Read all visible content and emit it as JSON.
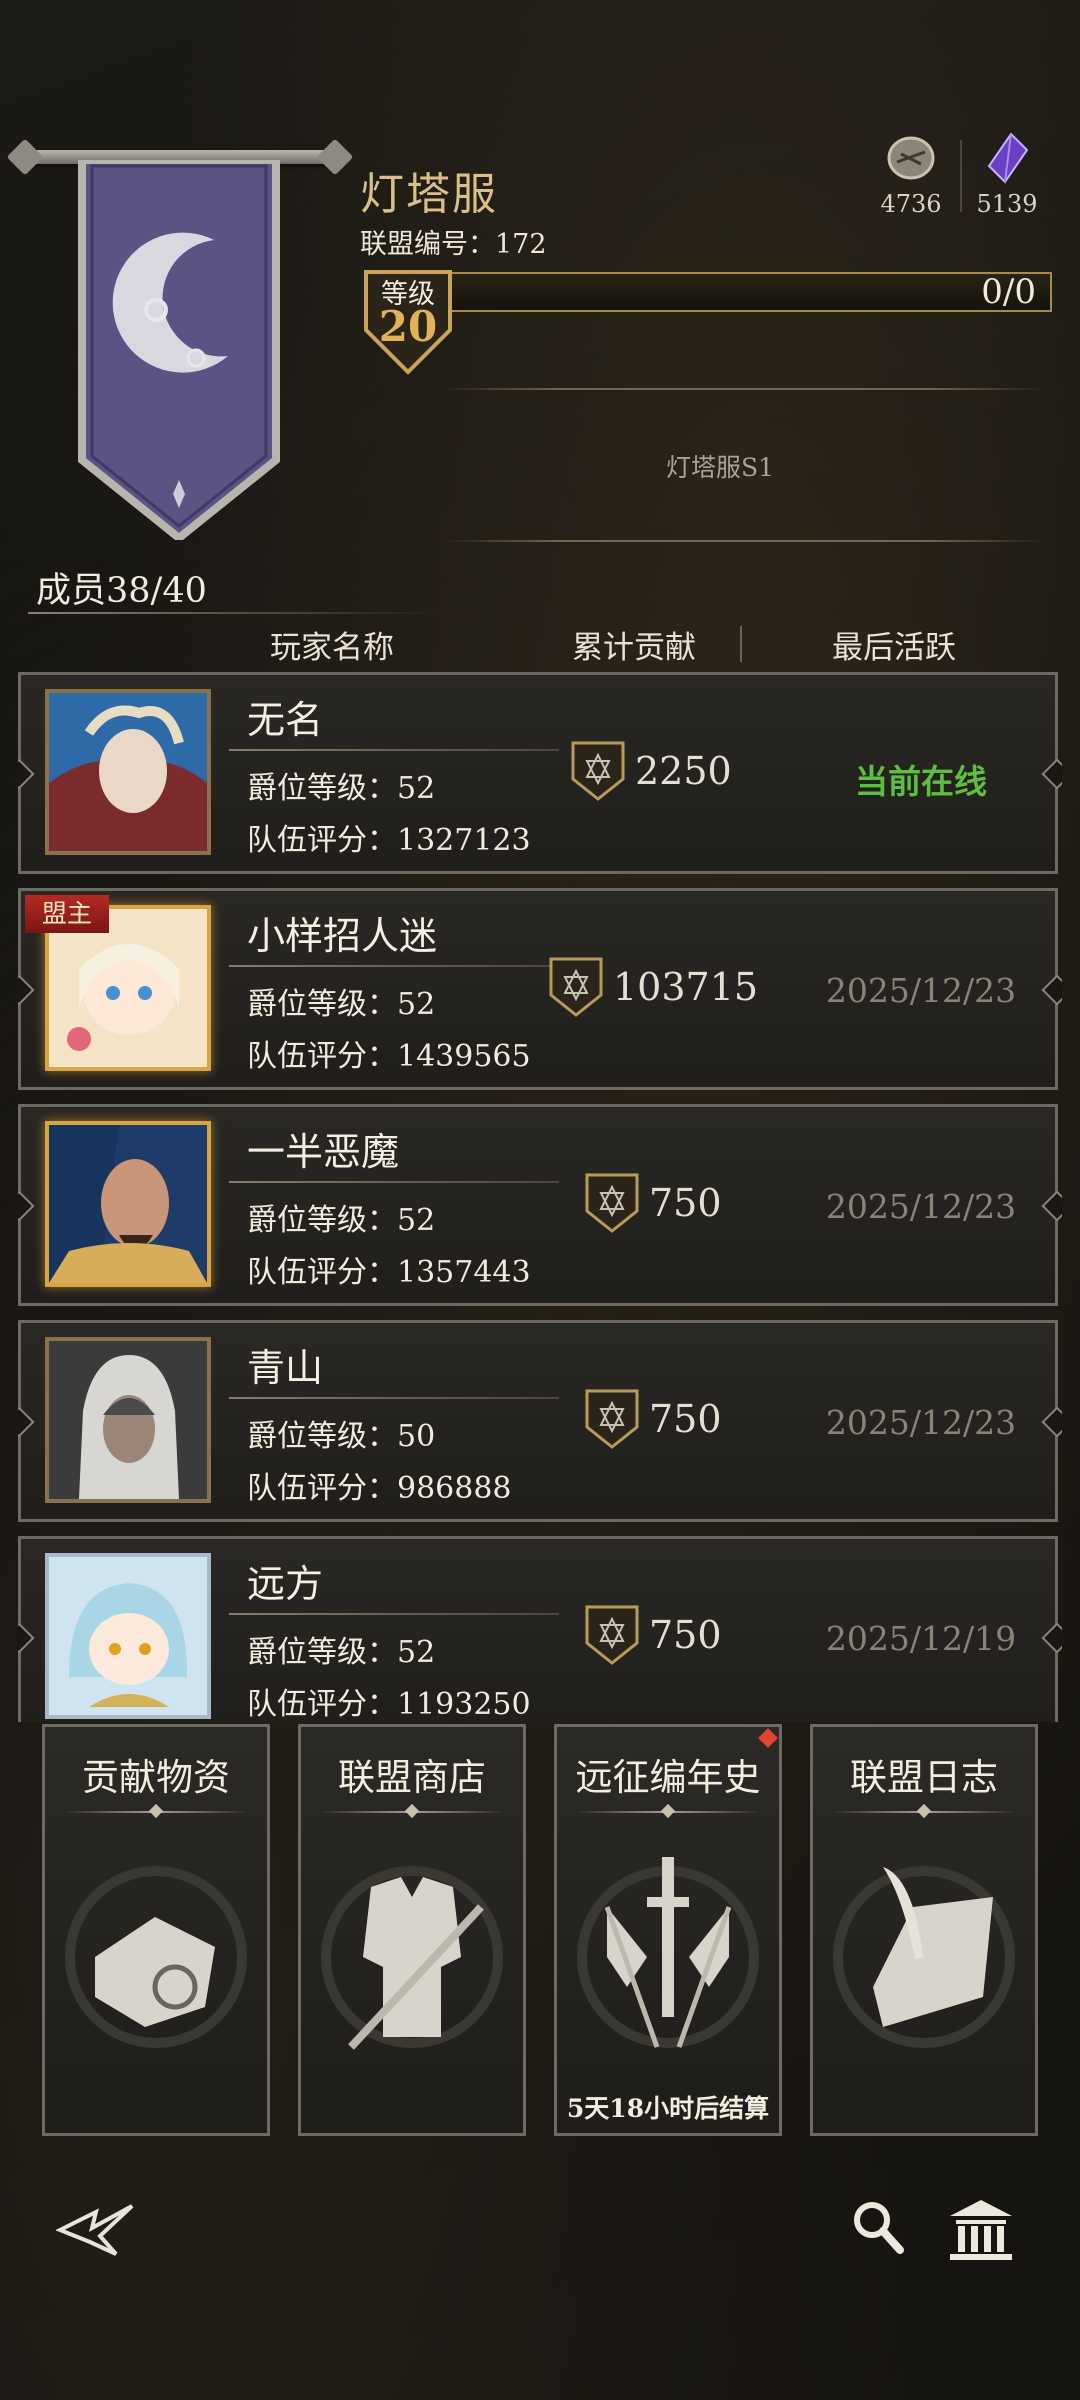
{
  "alliance": {
    "server_name": "灯塔服",
    "id_line": "联盟编号：172",
    "level_label": "等级",
    "level": "20",
    "progress": "0/0",
    "notice": "灯塔服S1",
    "members": "成员38/40"
  },
  "resources": [
    {
      "icon": "coin-icon",
      "value": "4736"
    },
    {
      "icon": "crystal-icon",
      "value": "5139"
    }
  ],
  "columns": {
    "name": "玩家名称",
    "contribution": "累计贡献",
    "last_active": "最后活跃"
  },
  "rank_label": "爵位等级：",
  "score_label": "队伍评分：",
  "leader_tag": "盟主",
  "members": [
    {
      "name": "无名",
      "rank": "52",
      "score": "1327123",
      "contribution": "2250",
      "last_active": "当前在线"
    },
    {
      "name": "小样招人迷",
      "rank": "52",
      "score": "1439565",
      "contribution": "103715",
      "last_active": "2025/12/23"
    },
    {
      "name": "一半恶魔",
      "rank": "52",
      "score": "1357443",
      "contribution": "750",
      "last_active": "2025/12/23"
    },
    {
      "name": "青山",
      "rank": "50",
      "score": "986888",
      "contribution": "750",
      "last_active": "2025/12/23"
    },
    {
      "name": "远方",
      "rank": "52",
      "score": "1193250",
      "contribution": "750",
      "last_active": "2025/12/19"
    }
  ],
  "tiles": [
    {
      "title": "贡献物资",
      "icon": "scroll-icon"
    },
    {
      "title": "联盟商店",
      "icon": "armor-icon"
    },
    {
      "title": "远征编年史",
      "icon": "sword-flags-icon",
      "note": "5天18小时后结算"
    },
    {
      "title": "联盟日志",
      "icon": "quill-icon"
    }
  ],
  "colors": {
    "gold": "#d9c08a",
    "online": "#5cbf3d",
    "leader_tag": "#b22b22",
    "banner": "#5a5384"
  }
}
